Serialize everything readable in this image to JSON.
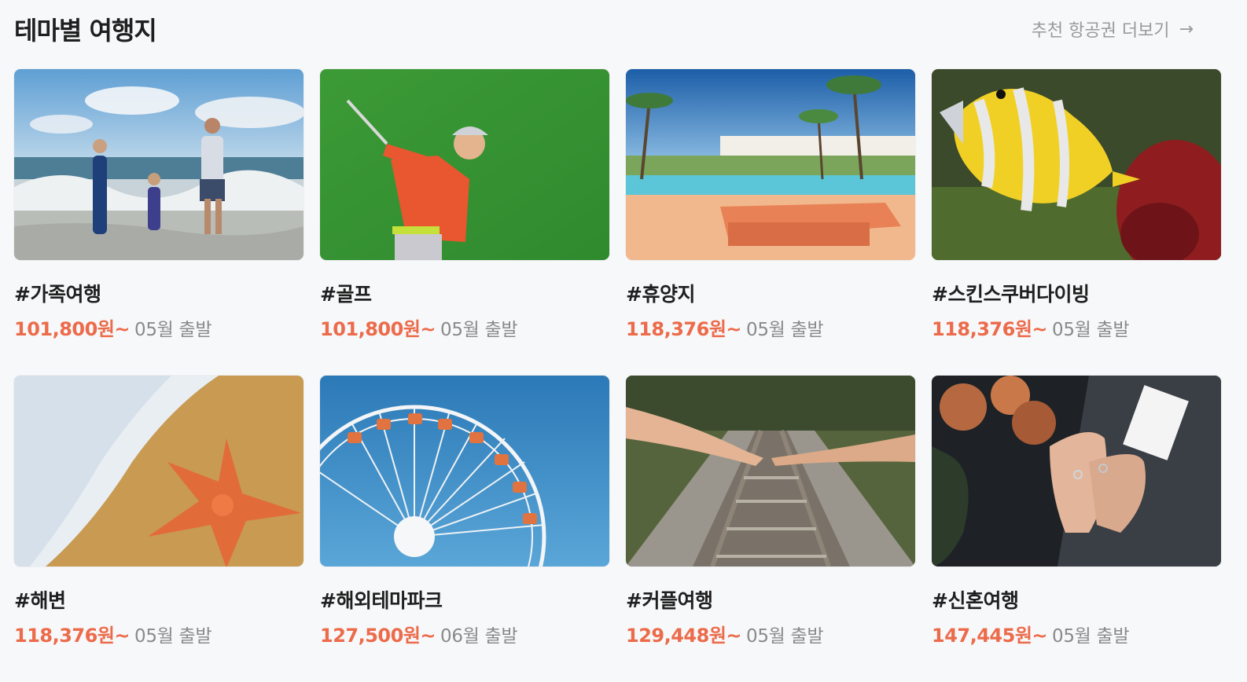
{
  "header": {
    "title": "테마별 여행지",
    "more_label": "추천 항공권 더보기",
    "more_arrow": "→"
  },
  "colors": {
    "price": "#ec6b4a",
    "muted": "#8a8a8a",
    "background": "#f7f8fa"
  },
  "cards": [
    {
      "tag": "#가족여행",
      "price": "101,800원~",
      "depart": "05월 출발",
      "image": "family-beach-photo"
    },
    {
      "tag": "#골프",
      "price": "101,800원~",
      "depart": "05월 출발",
      "image": "golfer-photo"
    },
    {
      "tag": "#휴양지",
      "price": "118,376원~",
      "depart": "05월 출발",
      "image": "resort-pool-photo"
    },
    {
      "tag": "#스킨스쿠버다이빙",
      "price": "118,376원~",
      "depart": "05월 출발",
      "image": "tropical-fish-photo"
    },
    {
      "tag": "#해변",
      "price": "118,376원~",
      "depart": "05월 출발",
      "image": "starfish-beach-photo"
    },
    {
      "tag": "#해외테마파크",
      "price": "127,500원~",
      "depart": "06월 출발",
      "image": "ferris-wheel-photo"
    },
    {
      "tag": "#커플여행",
      "price": "129,448원~",
      "depart": "05월 출발",
      "image": "couple-railway-photo"
    },
    {
      "tag": "#신혼여행",
      "price": "147,445원~",
      "depart": "05월 출발",
      "image": "wedding-rings-photo"
    }
  ]
}
